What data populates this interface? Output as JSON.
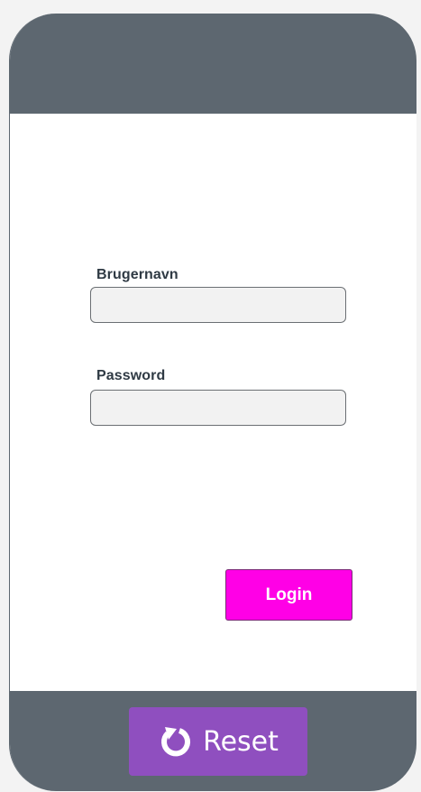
{
  "form": {
    "username_label": "Brugernavn",
    "username_value": "",
    "password_label": "Password",
    "password_value": "",
    "login_label": "Login"
  },
  "footer": {
    "reset_label": "Reset",
    "reset_icon": "rotate-cw-icon"
  },
  "colors": {
    "header": "#5d6770",
    "login_button": "#ff00e6",
    "reset_button": "#8f4fbf"
  }
}
